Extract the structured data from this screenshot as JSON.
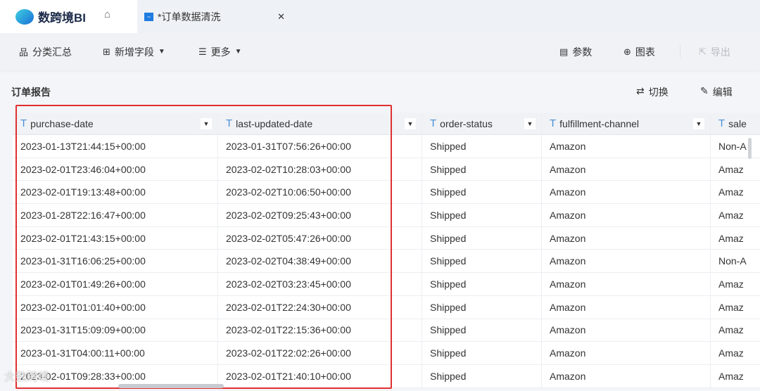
{
  "app": {
    "brand": "数跨境BI",
    "tab_title": "*订单数据清洗"
  },
  "toolbar": {
    "summary": "分类汇总",
    "add_field": "新增字段",
    "more": "更多",
    "params": "参数",
    "chart": "图表",
    "export": "导出"
  },
  "report": {
    "title": "订单报告",
    "switch": "切换",
    "edit": "编辑"
  },
  "table": {
    "columns": [
      "purchase-date",
      "last-updated-date",
      "order-status",
      "fulfillment-channel",
      "sale"
    ],
    "rows": [
      [
        "2023-01-13T21:44:15+00:00",
        "2023-01-31T07:56:26+00:00",
        "Shipped",
        "Amazon",
        "Non-A"
      ],
      [
        "2023-02-01T23:46:04+00:00",
        "2023-02-02T10:28:03+00:00",
        "Shipped",
        "Amazon",
        "Amaz"
      ],
      [
        "2023-02-01T19:13:48+00:00",
        "2023-02-02T10:06:50+00:00",
        "Shipped",
        "Amazon",
        "Amaz"
      ],
      [
        "2023-01-28T22:16:47+00:00",
        "2023-02-02T09:25:43+00:00",
        "Shipped",
        "Amazon",
        "Amaz"
      ],
      [
        "2023-02-01T21:43:15+00:00",
        "2023-02-02T05:47:26+00:00",
        "Shipped",
        "Amazon",
        "Amaz"
      ],
      [
        "2023-01-31T16:06:25+00:00",
        "2023-02-02T04:38:49+00:00",
        "Shipped",
        "Amazon",
        "Non-A"
      ],
      [
        "2023-02-01T01:49:26+00:00",
        "2023-02-02T03:23:45+00:00",
        "Shipped",
        "Amazon",
        "Amaz"
      ],
      [
        "2023-02-01T01:01:40+00:00",
        "2023-02-01T22:24:30+00:00",
        "Shipped",
        "Amazon",
        "Amaz"
      ],
      [
        "2023-01-31T15:09:09+00:00",
        "2023-02-01T22:15:36+00:00",
        "Shipped",
        "Amazon",
        "Amaz"
      ],
      [
        "2023-01-31T04:00:11+00:00",
        "2023-02-01T22:02:26+00:00",
        "Shipped",
        "Amazon",
        "Amaz"
      ],
      [
        "2023-02-01T09:28:33+00:00",
        "2023-02-01T21:40:10+00:00",
        "Shipped",
        "Amazon",
        "Amaz"
      ]
    ]
  },
  "watermark": "大数跨境"
}
